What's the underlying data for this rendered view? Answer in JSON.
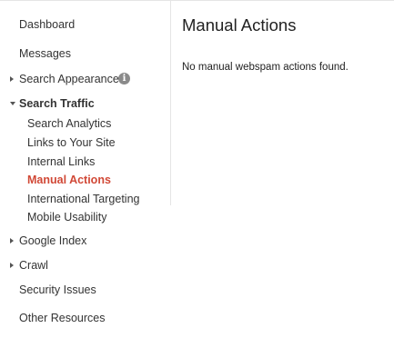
{
  "sidebar": {
    "dashboard": "Dashboard",
    "messages": "Messages",
    "search_appearance": "Search Appearance",
    "search_appearance_info_icon": "i",
    "search_traffic": "Search Traffic",
    "search_traffic_items": {
      "search_analytics": "Search Analytics",
      "links_to_your_site": "Links to Your Site",
      "internal_links": "Internal Links",
      "manual_actions": "Manual Actions",
      "international_targeting": "International Targeting",
      "mobile_usability": "Mobile Usability"
    },
    "google_index": "Google Index",
    "crawl": "Crawl",
    "security_issues": "Security Issues",
    "other_resources": "Other Resources",
    "active_color": "#d14836"
  },
  "main": {
    "title": "Manual Actions",
    "status": "No manual webspam actions found."
  }
}
